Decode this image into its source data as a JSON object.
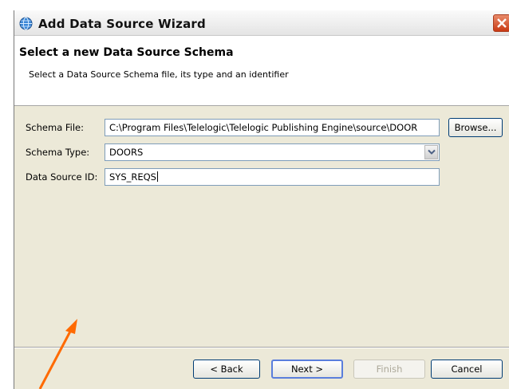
{
  "window": {
    "title": "Add Data Source Wizard"
  },
  "banner": {
    "title": "Select a new Data Source Schema",
    "description": "Select a Data Source Schema file, its type and an identifier"
  },
  "form": {
    "schema_file": {
      "label": "Schema File:",
      "value": "C:\\Program Files\\Telelogic\\Telelogic Publishing Engine\\source\\DOOR"
    },
    "browse_label": "Browse...",
    "schema_type": {
      "label": "Schema Type:",
      "value": "DOORS"
    },
    "data_source_id": {
      "label": "Data Source ID:",
      "value": "SYS_REQS"
    }
  },
  "buttons": {
    "back": "< Back",
    "next": "Next >",
    "finish": "Finish",
    "cancel": "Cancel"
  },
  "annotation": {
    "arrow_color": "#ff6a00"
  }
}
